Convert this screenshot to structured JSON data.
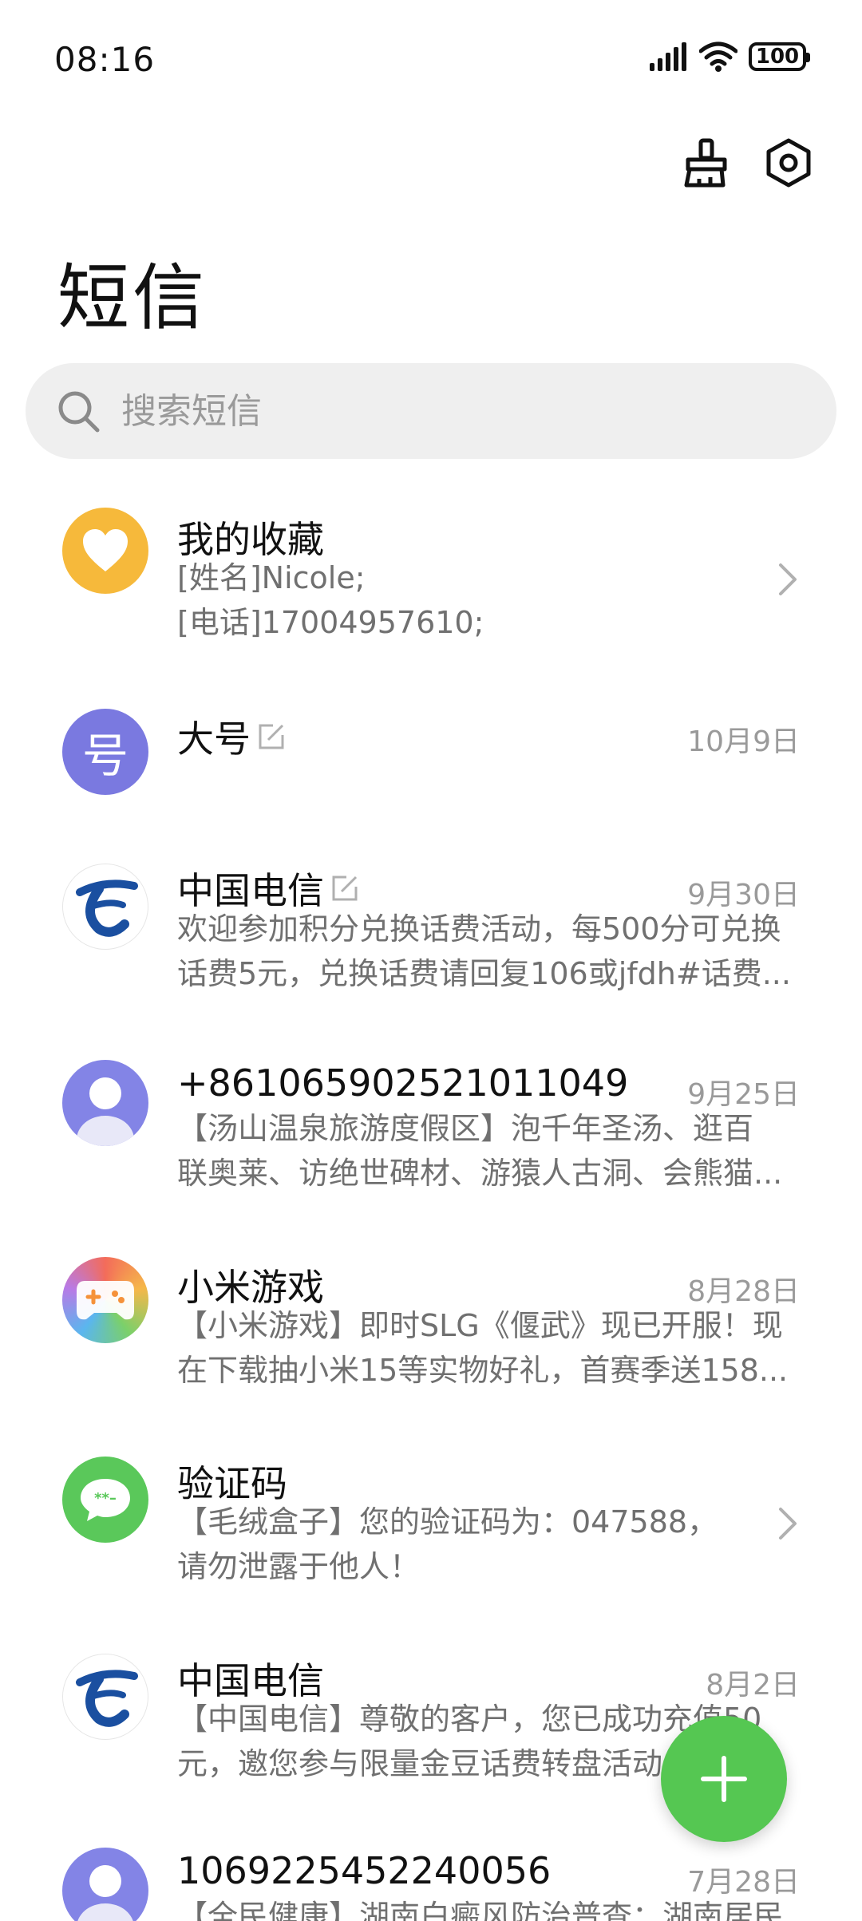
{
  "status_bar": {
    "time": "08:16",
    "battery": "100"
  },
  "header": {
    "title": "短信"
  },
  "search": {
    "placeholder": "搜索短信"
  },
  "conversations": [
    {
      "name": "我的收藏",
      "date": "",
      "preview": [
        "[姓名]Nicole;",
        "[电话]17004957610;"
      ],
      "avatar": "heart-icon",
      "avatar_color": "#f6b93b"
    },
    {
      "name": "大号",
      "date": "10月9日",
      "preview": [],
      "avatar": "hao-character",
      "avatar_text": "号",
      "avatar_color": "#7a79e0"
    },
    {
      "name": "中国电信",
      "date": "9月30日",
      "preview": [
        "欢迎参加积分兑换话费活动，每500分可兑换",
        "话费5元，兑换话费请回复106或jfdh#话费..."
      ],
      "avatar": "china-telecom-logo"
    },
    {
      "name": "+8610659025210110​49",
      "date": "9月25日",
      "preview": [
        "【汤山温泉旅游度假区】泡千年圣汤、逛百",
        "联奥莱、访绝世碑材、游猿人古洞、会熊猫..."
      ],
      "avatar": "person-icon"
    },
    {
      "name": "小米游戏",
      "date": "8月28日",
      "preview": [
        "【小米游戏】即时SLG《偃武》现已开服！现",
        "在下载抽小米15等实物好礼，首赛季送158..."
      ],
      "avatar": "game-controller-icon"
    },
    {
      "name": "验证码",
      "date": "",
      "preview": [
        "【毛绒盒子】您的验证码为：047588，",
        "请勿泄露于他人！"
      ],
      "avatar": "chat-bubble-icon",
      "avatar_color": "#5ac85a"
    },
    {
      "name": "中国电信",
      "date": "8月2日",
      "preview": [
        "【中国电信】尊敬的客户，您已成功充值50",
        "元，邀您参与限量金豆话费转盘活动..."
      ],
      "avatar": "china-telecom-logo"
    },
    {
      "name": "1069225452240056",
      "date": "7月28日",
      "preview": [
        "【全民健康】湖南白癜风防治普查：湖南居民",
        ""
      ],
      "avatar": "person-icon"
    }
  ],
  "colors": {
    "accent": "#55c752",
    "favorite": "#f6b93b",
    "purple": "#7a79e0",
    "telecom_blue": "#1a4fa0"
  }
}
